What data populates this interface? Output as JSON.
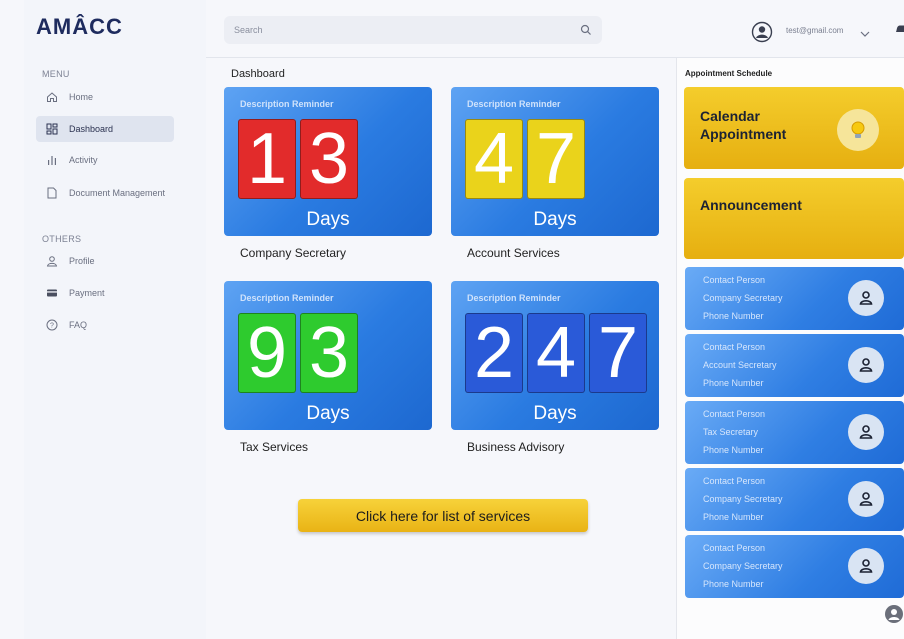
{
  "brand": {
    "logo": "AMÂCC"
  },
  "search": {
    "placeholder": "Search"
  },
  "user": {
    "email": "test@gmail.com"
  },
  "sidebar": {
    "menu_label": "MENU",
    "others_label": "OTHERS",
    "menu_items": [
      {
        "label": "Home",
        "icon": "home-icon"
      },
      {
        "label": "Dashboard",
        "icon": "dashboard-icon",
        "active": true
      },
      {
        "label": "Activity",
        "icon": "bar-chart-icon"
      },
      {
        "label": "Document Management",
        "icon": "document-icon"
      }
    ],
    "other_items": [
      {
        "label": "Profile",
        "icon": "profile-icon"
      },
      {
        "label": "Payment",
        "icon": "card-icon"
      },
      {
        "label": "FAQ",
        "icon": "help-icon"
      }
    ]
  },
  "main": {
    "title": "Dashboard",
    "cards": [
      {
        "label": "Description Reminder",
        "digits": [
          "1",
          "3"
        ],
        "digit_color": "#e22b2b",
        "unit": "Days",
        "name": "Company Secretary"
      },
      {
        "label": "Description Reminder",
        "digits": [
          "4",
          "7"
        ],
        "digit_color": "#ead31b",
        "unit": "Days",
        "name": "Account Services"
      },
      {
        "label": "Description Reminder",
        "digits": [
          "9",
          "3"
        ],
        "digit_color": "#2ecb2e",
        "unit": "Days",
        "name": "Tax Services"
      },
      {
        "label": "Description Reminder",
        "digits": [
          "2",
          "4",
          "7"
        ],
        "digit_color": "#2a5ad8",
        "unit": "Days",
        "name": "Business Advisory"
      }
    ],
    "cta_label": "Click here for list of services"
  },
  "schedule": {
    "title": "Appointment Schedule",
    "calendar_label": "Calendar Appointment",
    "announcement_label": "Announcement",
    "contacts": [
      {
        "line1": "Contact Person",
        "line2": "Company Secretary",
        "line3": "Phone Number"
      },
      {
        "line1": "Contact Person",
        "line2": "Account Secretary",
        "line3": "Phone Number"
      },
      {
        "line1": "Contact Person",
        "line2": "Tax Secretary",
        "line3": "Phone Number"
      },
      {
        "line1": "Contact Person",
        "line2": "Company Secretary",
        "line3": "Phone Number"
      },
      {
        "line1": "Contact Person",
        "line2": "Company Secretary",
        "line3": "Phone Number"
      }
    ]
  },
  "colors": {
    "accent_blue": "#2a7be1",
    "accent_gold": "#f0c020",
    "brand_navy": "#1e2b5e"
  }
}
